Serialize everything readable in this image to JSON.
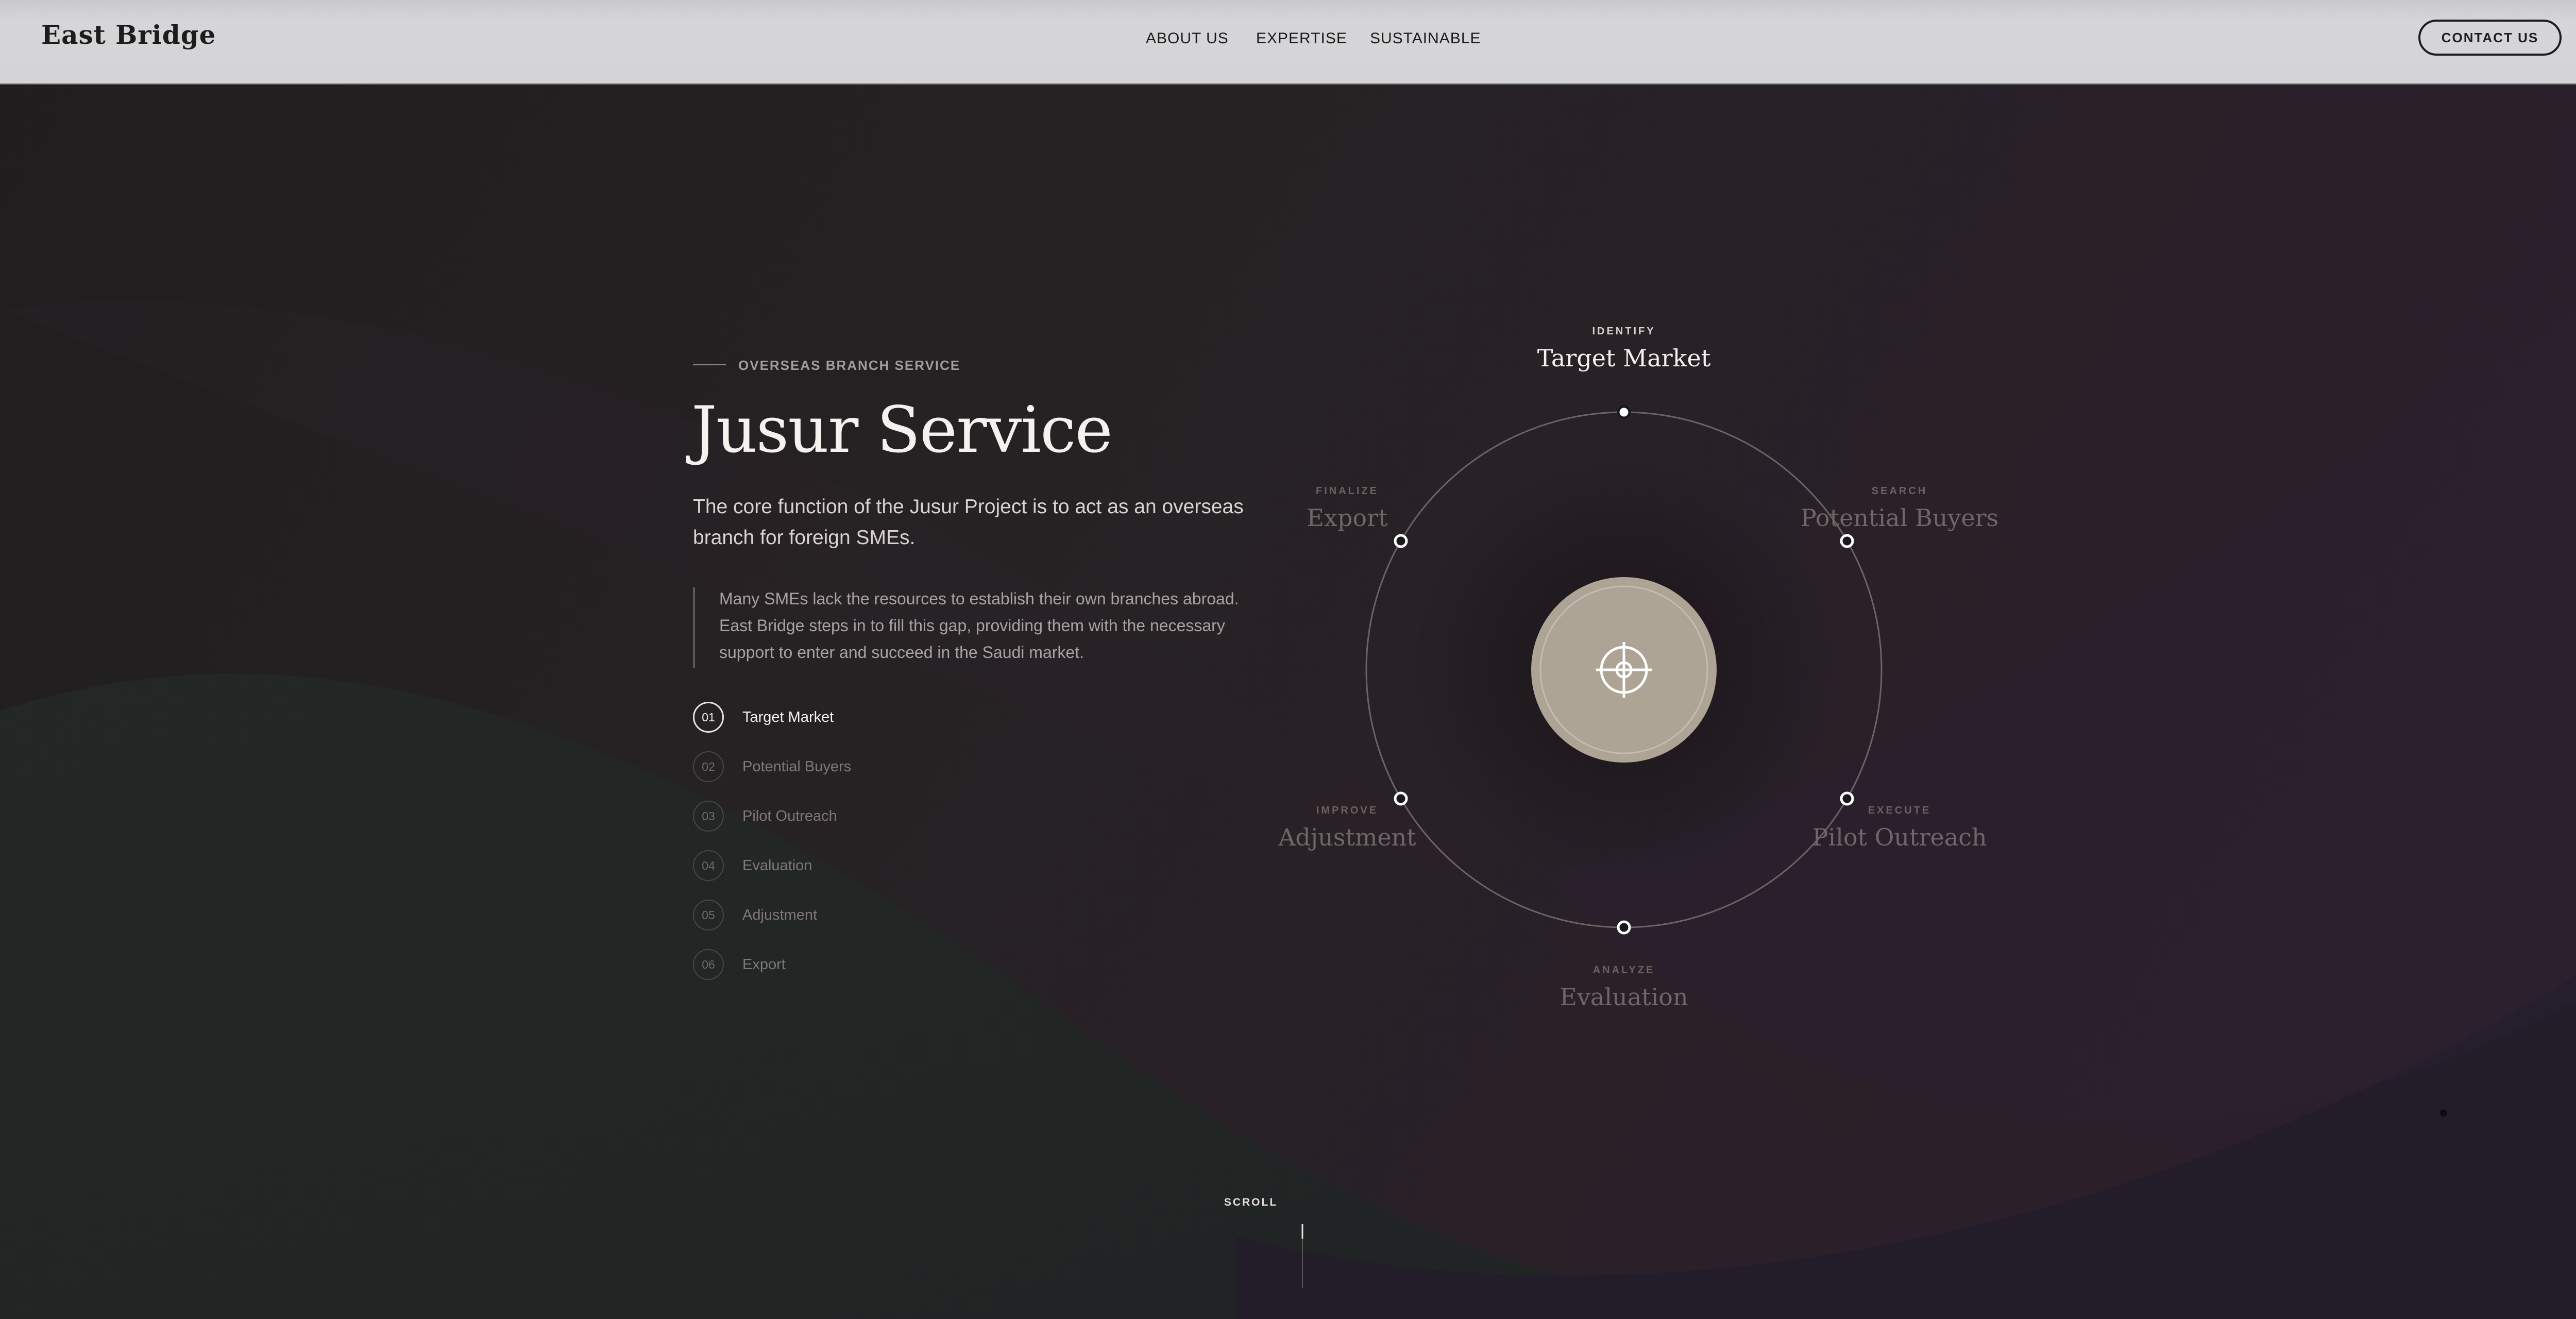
{
  "header": {
    "logo": "East Bridge",
    "nav": [
      "ABOUT US",
      "EXPERTISE",
      "SUSTAINABLE"
    ],
    "contact": "CONTACT US"
  },
  "hero": {
    "eyebrow": "OVERSEAS BRANCH SERVICE",
    "title": "Jusur Service",
    "lead": "The core function of the Jusur Project is to act as an overseas branch for foreign SMEs.",
    "quote": "Many SMEs lack the resources to establish their own branches abroad. East Bridge steps in to fill this gap, providing them with the necessary support to enter and succeed in the Saudi market.",
    "steps": [
      {
        "num": "01",
        "label": "Target Market",
        "active": true
      },
      {
        "num": "02",
        "label": "Potential Buyers",
        "active": false
      },
      {
        "num": "03",
        "label": "Pilot Outreach",
        "active": false
      },
      {
        "num": "04",
        "label": "Evaluation",
        "active": false
      },
      {
        "num": "05",
        "label": "Adjustment",
        "active": false
      },
      {
        "num": "06",
        "label": "Export",
        "active": false
      }
    ]
  },
  "cycle": {
    "center_icon": "crosshair-icon",
    "nodes": [
      {
        "small": "IDENTIFY",
        "big": "Target Market",
        "active": true
      },
      {
        "small": "SEARCH",
        "big": "Potential Buyers",
        "active": false
      },
      {
        "small": "EXECUTE",
        "big": "Pilot Outreach",
        "active": false
      },
      {
        "small": "ANALYZE",
        "big": "Evaluation",
        "active": false
      },
      {
        "small": "IMPROVE",
        "big": "Adjustment",
        "active": false
      },
      {
        "small": "FINALIZE",
        "big": "Export",
        "active": false
      }
    ]
  },
  "scroll": "SCROLL",
  "colors": {
    "header_bg": "#d4d3d5",
    "page_bg": "#211f20",
    "center_disc": "#ada496",
    "text_primary": "#f4f1ee"
  }
}
